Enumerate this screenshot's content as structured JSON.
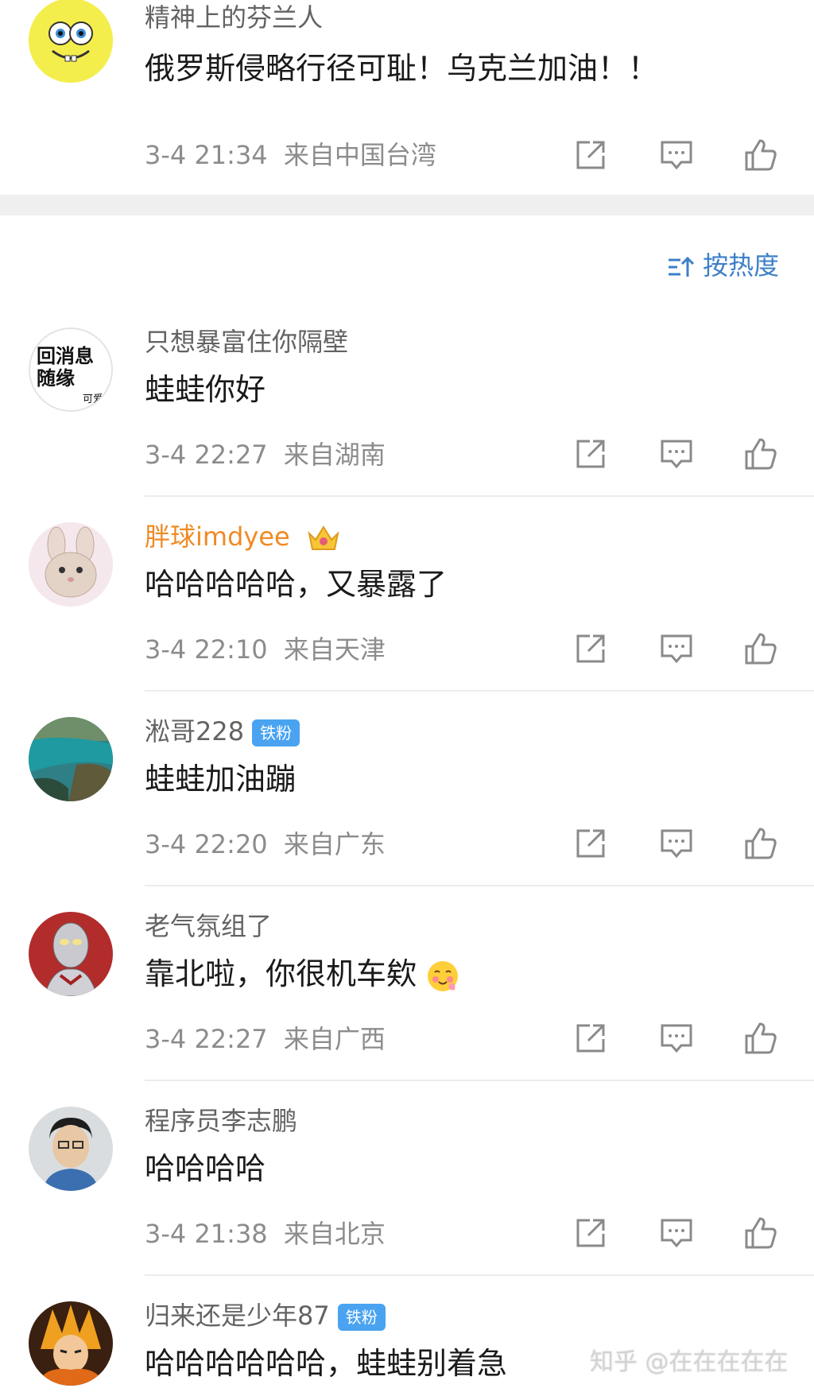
{
  "colors": {
    "accent": "#3d7fc8",
    "username_gold": "#f08a24",
    "badge": "#4aa3f0",
    "meta_gray": "#8c8c8c"
  },
  "sort": {
    "icon": "sort-icon",
    "label": "按热度"
  },
  "watermark": "知乎 @在在在在在",
  "top_comment": {
    "username": "精神上的芬兰人",
    "text": "俄罗斯侵略行径可耻！乌克兰加油！！",
    "time": "3-4 21:34",
    "location": "来自中国台湾"
  },
  "comments": [
    {
      "username": "只想暴富住你隔壁",
      "avatar_text": [
        "回消息",
        "随缘"
      ],
      "avatar_small": "可爱",
      "text": "蛙蛙你好",
      "time": "3-4 22:27",
      "location": "来自湖南"
    },
    {
      "username": "胖球imdyee",
      "text": "哈哈哈哈哈，又暴露了",
      "time": "3-4 22:10",
      "location": "来自天津"
    },
    {
      "username": "淞哥228",
      "badge": "铁粉",
      "text": "蛙蛙加油蹦",
      "time": "3-4 22:20",
      "location": "来自广东"
    },
    {
      "username": "老气氛组了",
      "text": "靠北啦，你很机车欸",
      "time": "3-4 22:27",
      "location": "来自广西"
    },
    {
      "username": "程序员李志鹏",
      "text": "哈哈哈哈",
      "time": "3-4 21:38",
      "location": "来自北京"
    },
    {
      "username": "归来还是少年87",
      "badge": "铁粉",
      "text": "哈哈哈哈哈哈，蛙蛙别着急"
    }
  ]
}
